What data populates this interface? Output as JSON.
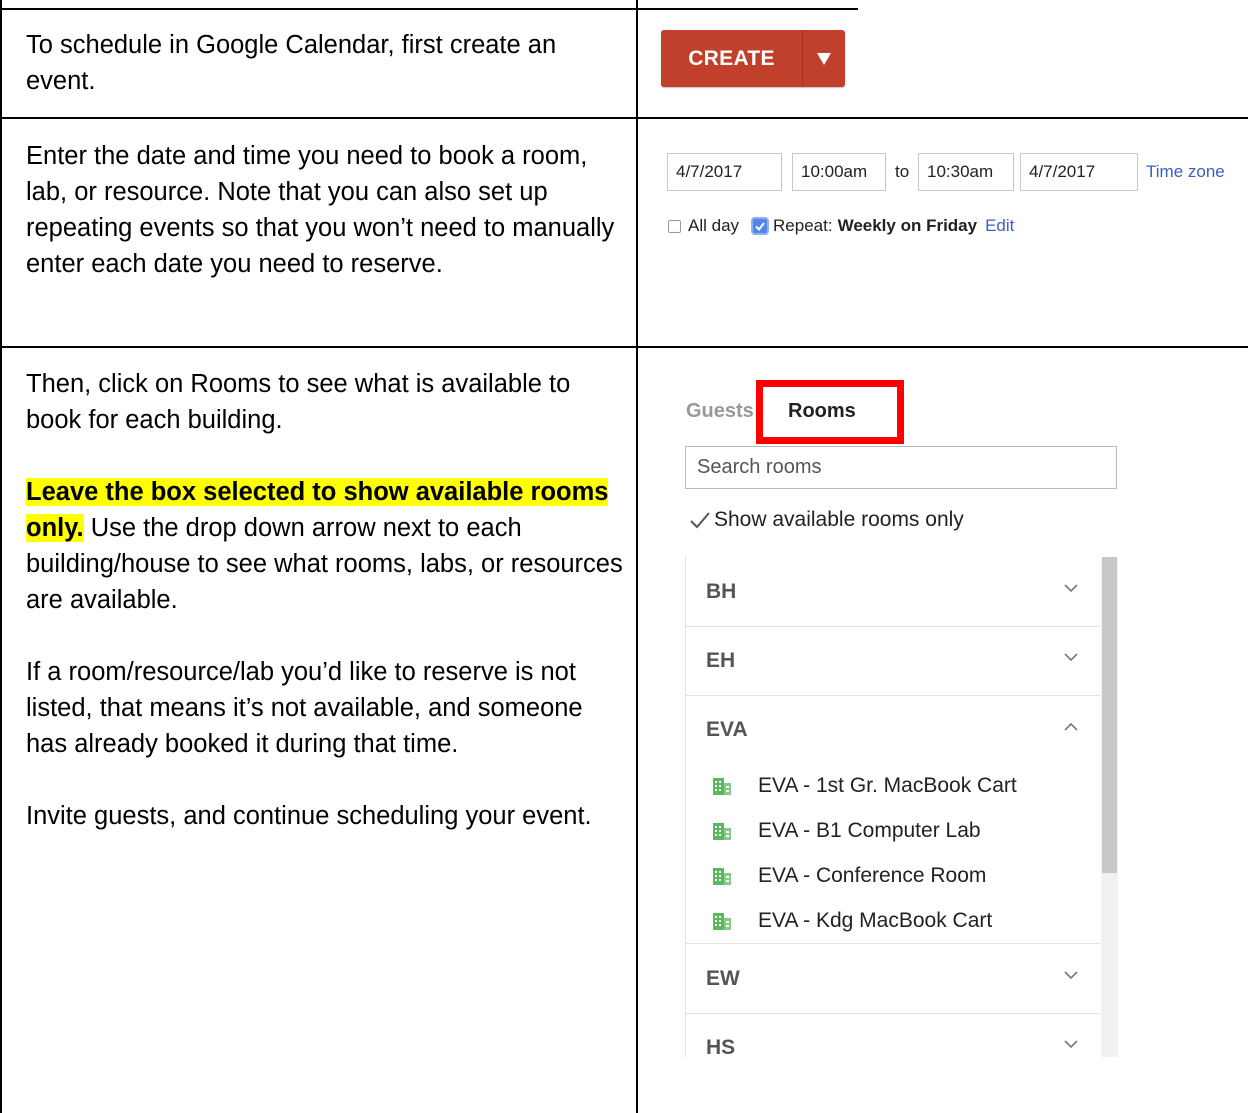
{
  "rows": [
    {
      "text": "To schedule in Google Calendar, first create an event."
    },
    {
      "text": "Enter the date and time you need to book a room, lab, or resource.  Note that you can also set up repeating events so that you won’t need to manually enter each date you need to reserve."
    },
    {
      "p1": "Then, click on Rooms to see what is available to book for each building.",
      "p2_highlight": "Leave the box selected to show available rooms only.",
      "p2_rest": "  Use the drop down arrow next to each building/house to see what rooms, labs, or resources are available.",
      "p3": "If a room/resource/lab you’d like to reserve is not listed, that means it’s not available, and someone has already booked it during that time.",
      "p4": "Invite guests, and continue scheduling your event."
    }
  ],
  "create_button": {
    "label": "CREATE",
    "color": "#c1402c"
  },
  "datetime": {
    "start_date": "4/7/2017",
    "start_time": "10:00am",
    "to_label": "to",
    "end_time": "10:30am",
    "end_date": "4/7/2017",
    "time_zone_link": "Time zone",
    "all_day_label": "All day",
    "all_day_checked": false,
    "repeat_checked": true,
    "repeat_label": "Repeat:",
    "repeat_value": "Weekly on Friday",
    "edit_link": "Edit"
  },
  "rooms_panel": {
    "tabs": [
      "Guests",
      "Rooms"
    ],
    "active_tab": "Rooms",
    "highlight_color": "#ff0000",
    "search_placeholder": "Search rooms",
    "show_available_label": "Show available rooms only",
    "show_available_checked": true,
    "buildings": [
      {
        "name": "BH",
        "expanded": false
      },
      {
        "name": "EH",
        "expanded": false
      },
      {
        "name": "EVA",
        "expanded": true,
        "rooms": [
          "EVA - 1st Gr. MacBook Cart",
          "EVA - B1 Computer Lab",
          "EVA - Conference Room",
          "EVA - Kdg MacBook Cart"
        ]
      },
      {
        "name": "EW",
        "expanded": false
      },
      {
        "name": "HS",
        "expanded": false
      }
    ],
    "room_icon": "building-icon",
    "room_icon_color": "#5cb85c"
  }
}
